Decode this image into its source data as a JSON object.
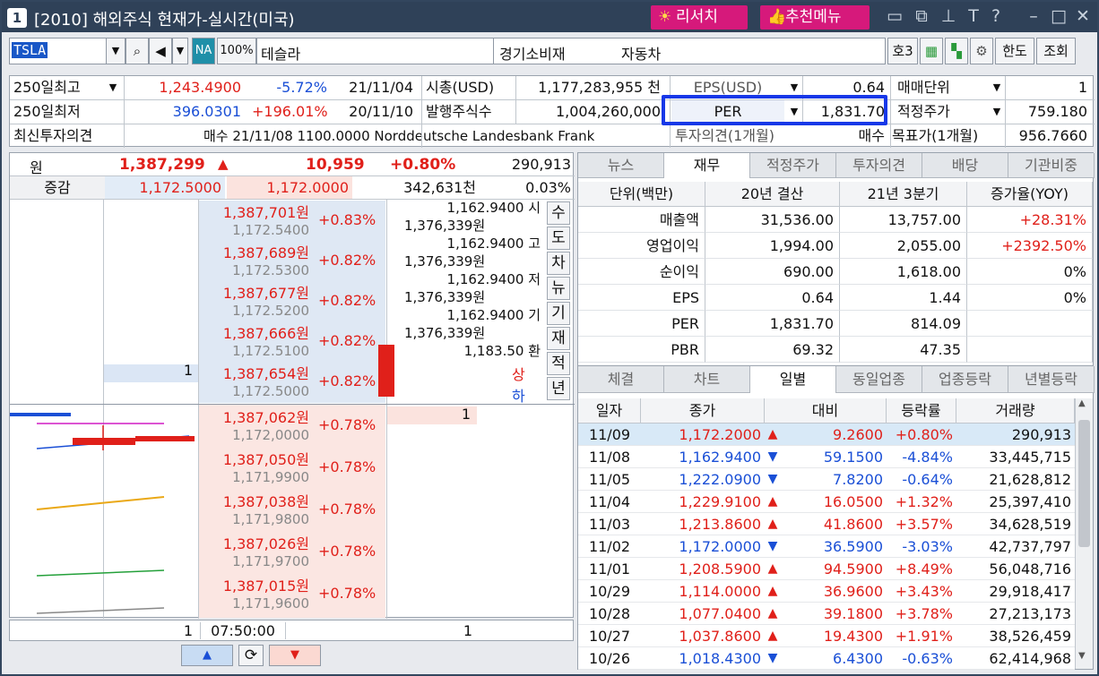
{
  "window": {
    "number": "1",
    "title": "[2010] 해외주식 현재가-실시간(미국)",
    "research_btn": "리서치",
    "menu_btn": "추천메뉴",
    "icons": [
      "layout-icon",
      "window-icon",
      "pin-icon",
      "font-icon",
      "help-icon",
      "minimize-icon",
      "maximize-icon",
      "close-icon"
    ]
  },
  "toolbar": {
    "ticker": "TSLA",
    "na_badge": "NA",
    "pct_badge": "100%",
    "name": "테슬라",
    "sector": "경기소비재",
    "industry": "자동차",
    "quote_btn": "호3",
    "limit_btn": "한도",
    "query_btn": "조회"
  },
  "info": {
    "row1": {
      "label": "250일최고",
      "value": "1,243.4900",
      "change": "-5.72%",
      "date": "21/11/04",
      "mcap_label": "시총(USD)",
      "mcap": "1,177,283,955 천",
      "eps_label": "EPS(USD)",
      "eps": "0.64",
      "unit_label": "매매단위",
      "unit": "1"
    },
    "row2": {
      "label": "250일최저",
      "value": "396.0301",
      "change": "+196.01%",
      "date": "20/11/10",
      "shares_label": "발행주식수",
      "shares": "1,004,260,000",
      "per_label": "PER",
      "per": "1,831.70",
      "fair_label": "적정주가",
      "fair": "759.180"
    },
    "row3": {
      "label": "최신투자의견",
      "text": "매수  21/11/08 1100.0000 Norddeutsche Landesbank Frank",
      "opinion_label": "투자의견(1개월)",
      "opinion": "매수",
      "target_label": "목표가(1개월)",
      "target": "956.7660"
    }
  },
  "quote": {
    "won_label": "원",
    "won_price": "1,387,299",
    "won_arrow": "▲",
    "won_change": "10,959",
    "won_pct": "+0.80%",
    "volume": "290,913",
    "diff_label": "증감",
    "price1": "1,172.5000",
    "price2": "1,172.0000",
    "amount": "342,631천",
    "amount_pct": "0.03%"
  },
  "asks": [
    {
      "won": "1,387,701원",
      "usd": "1,172.5400",
      "pct": "+0.83%"
    },
    {
      "won": "1,387,689원",
      "usd": "1,172.5300",
      "pct": "+0.82%"
    },
    {
      "won": "1,387,677원",
      "usd": "1,172.5200",
      "pct": "+0.82%"
    },
    {
      "won": "1,387,666원",
      "usd": "1,172.5100",
      "pct": "+0.82%"
    },
    {
      "won": "1,387,654원",
      "usd": "1,172.5000",
      "pct": "+0.82%",
      "qty": "1"
    }
  ],
  "bids": [
    {
      "won": "1,387,062원",
      "usd": "1,172,0000",
      "pct": "+0.78%",
      "qty": "1"
    },
    {
      "won": "1,387,050원",
      "usd": "1,171,9900",
      "pct": "+0.78%"
    },
    {
      "won": "1,387,038원",
      "usd": "1,171,9800",
      "pct": "+0.78%"
    },
    {
      "won": "1,387,026원",
      "usd": "1,171,9700",
      "pct": "+0.78%"
    },
    {
      "won": "1,387,015원",
      "usd": "1,171,9600",
      "pct": "+0.78%"
    }
  ],
  "ref_lines": [
    "1,162.9400 시",
    "1,376,339원",
    "1,162.9400 고",
    "1,376,339원",
    "1,162.9400 저",
    "1,376,339원",
    "1,162.9400 기",
    "1,376,339원",
    "1,183.50 환"
  ],
  "upper": "상",
  "lower": "하",
  "side_buttons": [
    "수",
    "도",
    "차",
    "뉴",
    "기",
    "재",
    "적",
    "년"
  ],
  "book_footer": {
    "left_qty": "1",
    "time": "07:50:00",
    "right_qty": "1"
  },
  "tabs_top": [
    "뉴스",
    "재무",
    "적정주가",
    "투자의견",
    "배당",
    "기관비중"
  ],
  "fin": {
    "headers": [
      "단위(백만)",
      "20년 결산",
      "21년 3분기",
      "증가율(YOY)"
    ],
    "rows": [
      [
        "매출액",
        "31,536.00",
        "13,757.00",
        "+28.31%"
      ],
      [
        "영업이익",
        "1,994.00",
        "2,055.00",
        "+2392.50%"
      ],
      [
        "순이익",
        "690.00",
        "1,618.00",
        "0%"
      ],
      [
        "EPS",
        "0.64",
        "1.44",
        "0%"
      ],
      [
        "PER",
        "1,831.70",
        "814.09",
        ""
      ],
      [
        "PBR",
        "69.32",
        "47.35",
        ""
      ]
    ]
  },
  "tabs_bottom": [
    "체결",
    "차트",
    "일별",
    "동일업종",
    "업종등락",
    "년별등락"
  ],
  "daily": {
    "headers": [
      "일자",
      "종가",
      "대비",
      "등락률",
      "거래량"
    ],
    "rows": [
      [
        "11/09",
        "1,172.2000",
        "up",
        "9.2600",
        "+0.80%",
        "290,913"
      ],
      [
        "11/08",
        "1,162.9400",
        "dn",
        "59.1500",
        "-4.84%",
        "33,445,715"
      ],
      [
        "11/05",
        "1,222.0900",
        "dn",
        "7.8200",
        "-0.64%",
        "21,628,812"
      ],
      [
        "11/04",
        "1,229.9100",
        "up",
        "16.0500",
        "+1.32%",
        "25,397,410"
      ],
      [
        "11/03",
        "1,213.8600",
        "up",
        "41.8600",
        "+3.57%",
        "34,628,519"
      ],
      [
        "11/02",
        "1,172.0000",
        "dn",
        "36.5900",
        "-3.03%",
        "42,737,797"
      ],
      [
        "11/01",
        "1,208.5900",
        "up",
        "94.5900",
        "+8.49%",
        "56,048,716"
      ],
      [
        "10/29",
        "1,114.0000",
        "up",
        "36.9600",
        "+3.43%",
        "29,918,417"
      ],
      [
        "10/28",
        "1,077.0400",
        "up",
        "39.1800",
        "+3.78%",
        "27,213,173"
      ],
      [
        "10/27",
        "1,037.8600",
        "up",
        "19.4300",
        "+1.91%",
        "38,526,459"
      ],
      [
        "10/26",
        "1,018.4300",
        "dn",
        "6.4300",
        "-0.63%",
        "62,414,968"
      ]
    ]
  }
}
